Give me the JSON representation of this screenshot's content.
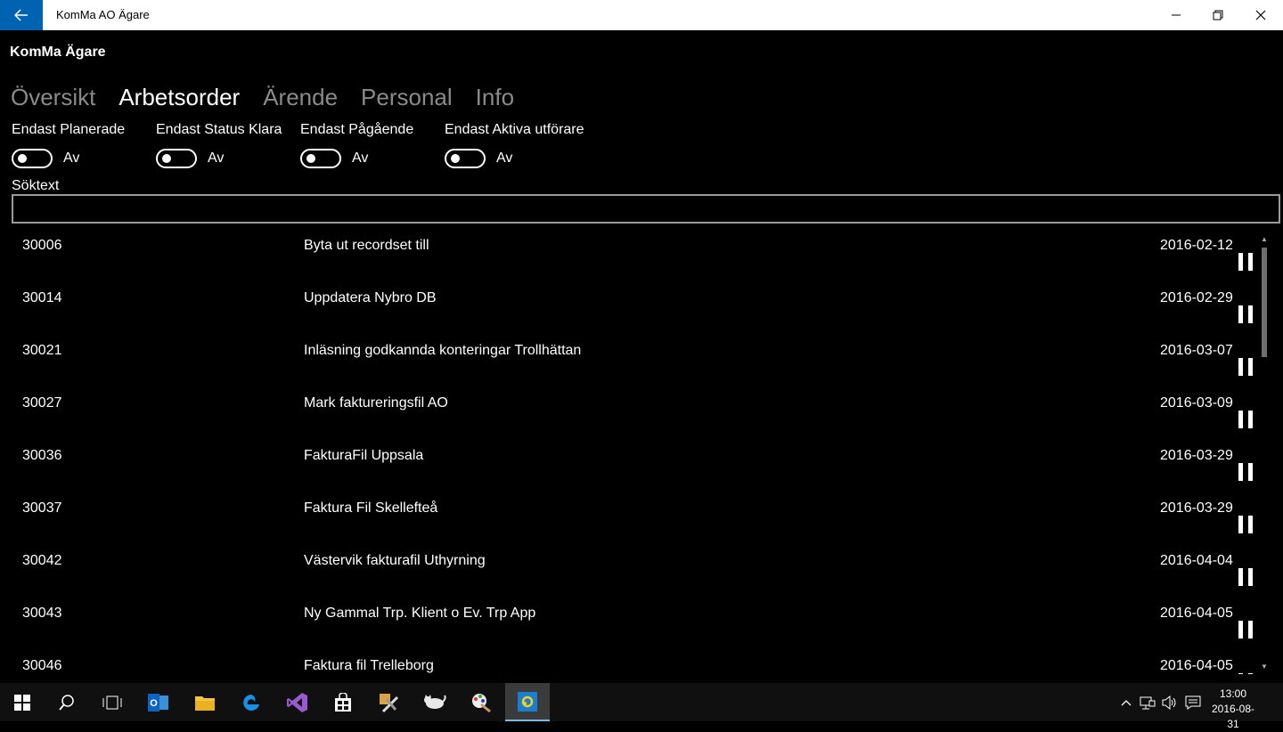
{
  "window": {
    "title": "KomMa AO Ägare"
  },
  "app": {
    "title": "KomMa Ägare"
  },
  "tabs": [
    {
      "label": "Översikt",
      "active": false
    },
    {
      "label": "Arbetsorder",
      "active": true
    },
    {
      "label": "Ärende",
      "active": false
    },
    {
      "label": "Personal",
      "active": false
    },
    {
      "label": "Info",
      "active": false
    }
  ],
  "filters": [
    {
      "label": "Endast Planerade",
      "state": "Av"
    },
    {
      "label": "Endast Status Klara",
      "state": "Av"
    },
    {
      "label": "Endast Pågående",
      "state": "Av"
    },
    {
      "label": "Endast Aktiva utförare",
      "state": "Av"
    }
  ],
  "search": {
    "label": "Söktext",
    "value": "",
    "placeholder": ""
  },
  "work_orders": [
    {
      "id": "30006",
      "title": "Byta ut recordset till",
      "date": "2016-02-12"
    },
    {
      "id": "30014",
      "title": "Uppdatera Nybro DB",
      "date": "2016-02-29"
    },
    {
      "id": "30021",
      "title": "Inläsning godkannda konteringar Trollhättan",
      "date": "2016-03-07"
    },
    {
      "id": "30027",
      "title": "Mark faktureringsfil AO",
      "date": "2016-03-09"
    },
    {
      "id": "30036",
      "title": "FakturaFil Uppsala",
      "date": "2016-03-29"
    },
    {
      "id": "30037",
      "title": "Faktura Fil Skellefteå",
      "date": "2016-03-29"
    },
    {
      "id": "30042",
      "title": "Västervik fakturafil Uthyrning",
      "date": "2016-04-04"
    },
    {
      "id": "30043",
      "title": "Ny Gammal Trp. Klient o Ev. Trp App",
      "date": "2016-04-05"
    },
    {
      "id": "30046",
      "title": "Faktura fil Trelleborg",
      "date": "2016-04-05"
    }
  ],
  "taskbar": {
    "clock_time": "13:00",
    "clock_date": "2016-08-31"
  },
  "colors": {
    "accent": "#0063b1",
    "background": "#000000",
    "inactive_tab": "#8a8a8a"
  }
}
